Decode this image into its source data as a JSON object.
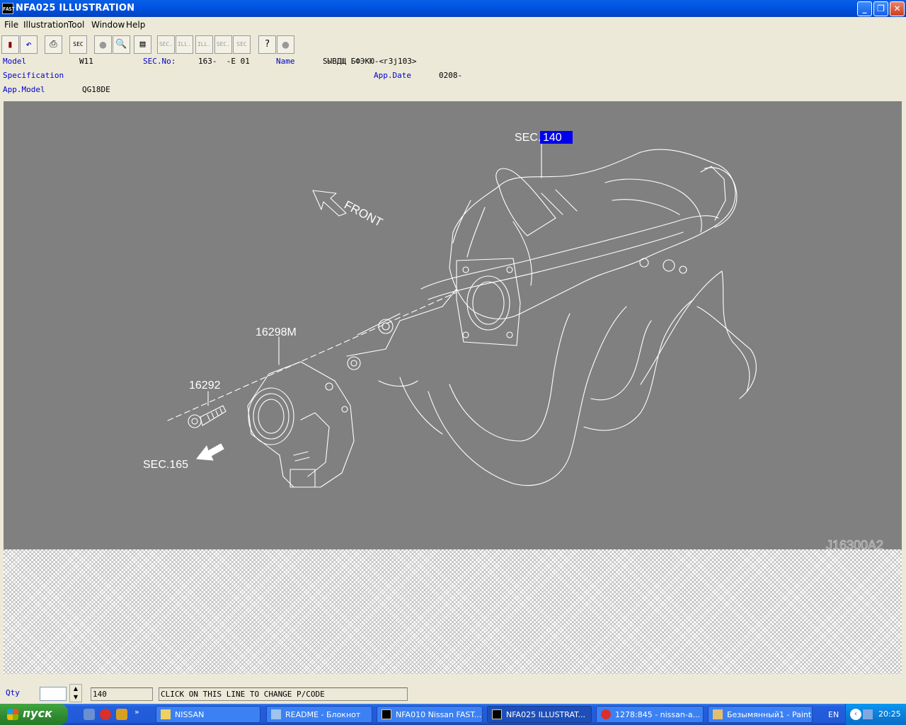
{
  "window": {
    "title": "NFA025  ILLUSTRATION",
    "icon_text": "FAST"
  },
  "menu": [
    "File",
    "Illustration",
    "Tool",
    "Window",
    "Help"
  ],
  "toolbar": {
    "sec1": "SEC",
    "sec2": "SEC.",
    "ill1": "ILL.",
    "ill2": "ILL.",
    "sec3": "SEC.",
    "sec4": "SEC"
  },
  "info": {
    "model_label": "Model",
    "model_value": "W11",
    "secno_label": "SEC.No:",
    "secno_value": "163-  -E 01",
    "name_label": "Name",
    "name_value": "ЅЫВДЩ БФЭКЮ-<г3j103>",
    "spec_label": "Specification",
    "appdate_label": "App.Date",
    "appdate_value": "0208-",
    "appmodel_label": "App.Model",
    "appmodel_value": "QG18DE"
  },
  "illustration": {
    "sec140_prefix": "SEC.",
    "sec140_value": "140",
    "front": "FRONT",
    "part_16298m": "16298M",
    "part_16292": "16292",
    "sec165": "SEC.165",
    "code": "J16300A2"
  },
  "bottom": {
    "qty_label": "Qty",
    "qty_value": "",
    "code_value": "140",
    "message": "CLICK ON THIS LINE TO CHANGE P/CODE"
  },
  "taskbar": {
    "start": "пуск",
    "tasks": [
      "NISSAN",
      "README - Блокнот",
      "NFA010 Nissan FAST...",
      "NFA025  ILLUSTRAT...",
      "1278:845 - nissan-a...",
      "Безымянный1 - Paint"
    ],
    "lang": "EN",
    "clock": "20:25"
  },
  "colors": {
    "title_blue": "#0054e3",
    "illus_bg": "#808080",
    "label_blue": "#0000cc",
    "highlight": "#0000ee"
  }
}
